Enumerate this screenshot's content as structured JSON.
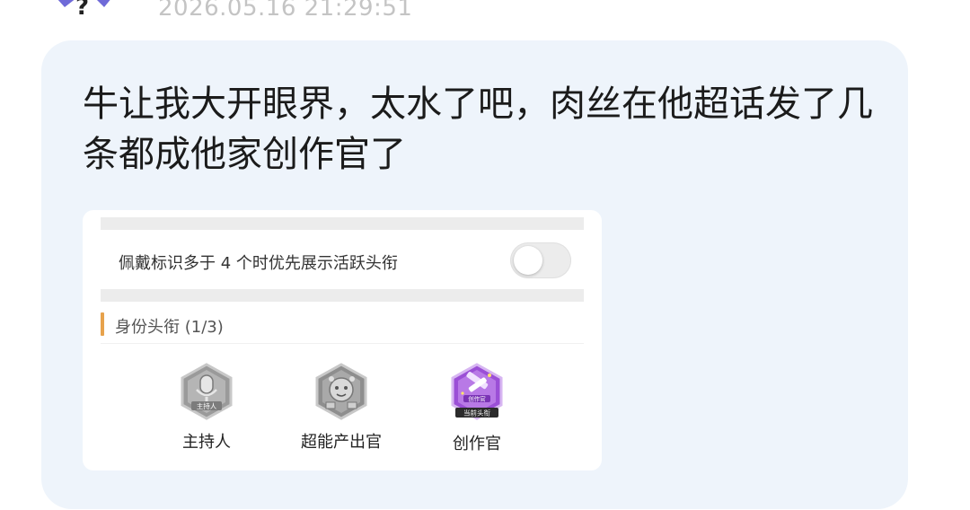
{
  "timestamp": "2026.05.16 21:29:51",
  "post": {
    "text": "牛让我大开眼界，太水了吧，肉丝在他超话发了几条都成他家创作官了"
  },
  "card": {
    "toggle_label": "佩戴标识多于 4 个时优先展示活跃头衔",
    "toggle_on": false,
    "section_title": "身份头衔 (1/3)",
    "badges": [
      {
        "label": "主持人",
        "emblem_text": "主持人",
        "icon": "microphone-icon",
        "active": false
      },
      {
        "label": "超能产出官",
        "icon": "rock-creature-icon",
        "active": false
      },
      {
        "label": "创作官",
        "emblem_text": "创作官",
        "ribbon_text": "当前头衔",
        "icon": "pencil-ruler-icon",
        "active": true,
        "color": "#9b4fd6"
      }
    ]
  },
  "colors": {
    "bubble_bg": "#eef4fb",
    "accent_bar": "#e7a24c",
    "badge_active": "#9b4fd6"
  }
}
